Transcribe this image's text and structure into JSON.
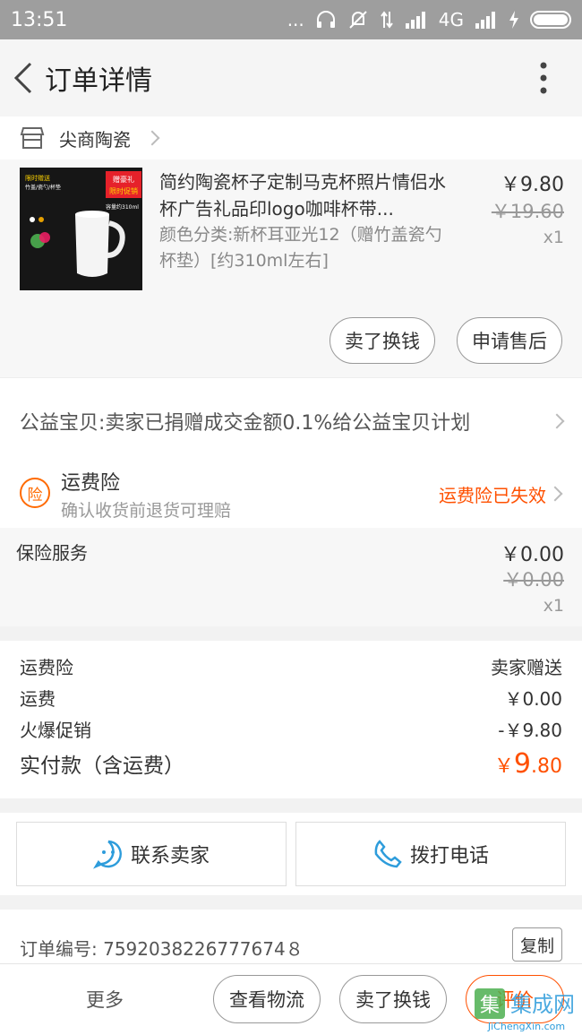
{
  "status_bar": {
    "time": "13:51",
    "signal_dots": "...",
    "network": "4G"
  },
  "app_bar": {
    "title": "订单详情"
  },
  "shop": {
    "name": "尖商陶瓷"
  },
  "item": {
    "title": "简约陶瓷杯子定制马克杯照片情侣水杯广告礼品印logo咖啡杯带...",
    "sku": "颜色分类:新杯耳亚光12（赠竹盖瓷勺杯垫）[约310ml左右]",
    "price": "￥9.80",
    "original_price": "￥19.60",
    "quantity": "x1",
    "thumb_badge": "赠豪礼",
    "thumb_badge2": "限时促销",
    "thumb_left": "限时赠送",
    "thumb_left2": "竹盖/瓷勺/杯垫",
    "thumb_cap": "容量约310ml",
    "sell_label": "卖了换钱",
    "aftersale_label": "申请售后"
  },
  "charity": {
    "text": "公益宝贝:卖家已捐赠成交金额0.1%给公益宝贝计划"
  },
  "insurance": {
    "icon_text": "险",
    "title": "运费险",
    "subtitle": "确认收货前退货可理赔",
    "status": "运费险已失效"
  },
  "service": {
    "label": "保险服务",
    "price": "￥0.00",
    "original_price": "￥0.00",
    "quantity": "x1"
  },
  "summary": {
    "rows": [
      {
        "label": "运费险",
        "value": "卖家赠送"
      },
      {
        "label": "运费",
        "value": "￥0.00"
      },
      {
        "label": "火爆促销",
        "value": "-￥9.80"
      }
    ],
    "total_label": "实付款（含运费）",
    "total_currency": "￥",
    "total_int": "9",
    "total_dec": ".80"
  },
  "contact": {
    "seller_label": "联系卖家",
    "call_label": "拨打电话"
  },
  "order": {
    "number_text": "订单编号: 7592038226777674８",
    "copy_label": "复制"
  },
  "bottom_bar": {
    "more_label": "更多",
    "logistics_label": "查看物流",
    "sell_label": "卖了换钱",
    "review_label": "评价"
  },
  "watermark": {
    "brand": "集成网",
    "url": "JiChengXin.com"
  },
  "colors": {
    "accent": "#ff5000",
    "blue": "#2d9cdb",
    "status_bar": "#9e9e9e"
  }
}
